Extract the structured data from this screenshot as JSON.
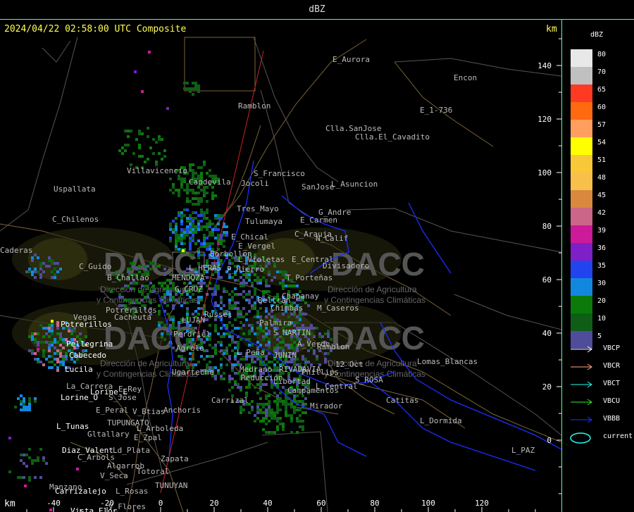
{
  "window": {
    "title": "dBZ"
  },
  "map": {
    "timestamp": "2024/04/22 02:58:00 UTC Composite",
    "km_unit_top": "km",
    "km_unit_bottom": "km",
    "x_ticks": [
      "-40",
      "-20",
      "0",
      "20",
      "40",
      "60",
      "80",
      "100",
      "120"
    ],
    "y_ticks": [
      "140",
      "120",
      "100",
      "80",
      "60",
      "40",
      "20",
      "0"
    ],
    "watermark": {
      "brand": "DACC",
      "line1": "Dirección de Agricultura",
      "line2": "y Contingencias Climáticas"
    },
    "places": [
      {
        "name": "Ramblon",
        "c": "#bbb"
      },
      {
        "name": "Encon",
        "c": "#bbb"
      },
      {
        "name": "E_1-736",
        "c": "#bbb"
      },
      {
        "name": "Clla.SanJose",
        "c": "#bbb"
      },
      {
        "name": "Clla.El_Cavadito",
        "c": "#bbb"
      },
      {
        "name": "Villavicencio",
        "c": "#bbb"
      },
      {
        "name": "SanJose",
        "c": "#bbb"
      },
      {
        "name": "S_Francisco",
        "c": "#bbb"
      },
      {
        "name": "Capdevila",
        "c": "#bbb"
      },
      {
        "name": "Jocoli",
        "c": "#bbb"
      },
      {
        "name": "L_Asuncion",
        "c": "#bbb"
      },
      {
        "name": "Uspallata",
        "c": "#bbb"
      },
      {
        "name": "Tres_Mayo",
        "c": "#bbb"
      },
      {
        "name": "G_Andre",
        "c": "#bbb"
      },
      {
        "name": "Tulumaya",
        "c": "#bbb"
      },
      {
        "name": "E_Carmen",
        "c": "#bbb"
      },
      {
        "name": "C_Chilenos",
        "c": "#bbb"
      },
      {
        "name": "E_Chical",
        "c": "#bbb"
      },
      {
        "name": "C_Arauja",
        "c": "#bbb"
      },
      {
        "name": "N_Calif",
        "c": "#bbb"
      },
      {
        "name": "E_Vergel",
        "c": "#bbb"
      },
      {
        "name": "Borbollon",
        "c": "#bbb"
      },
      {
        "name": "L_Violetas",
        "c": "#bbb"
      },
      {
        "name": "E_Central",
        "c": "#bbb"
      },
      {
        "name": "Divisadero",
        "c": "#bbb"
      },
      {
        "name": "C_Guido",
        "c": "#bbb"
      },
      {
        "name": "L_HERAS",
        "c": "#bbb"
      },
      {
        "name": "P_Hierro",
        "c": "#bbb"
      },
      {
        "name": "MENDOZA",
        "c": "#bbb"
      },
      {
        "name": "B_Challao",
        "c": "#bbb"
      },
      {
        "name": "T_Porteñas",
        "c": "#bbb"
      },
      {
        "name": "G_CRUZ",
        "c": "#bbb"
      },
      {
        "name": "Chapanay",
        "c": "#bbb"
      },
      {
        "name": "Beltran",
        "c": "#bbb"
      },
      {
        "name": "Chimbas",
        "c": "#bbb"
      },
      {
        "name": "M_Caseros",
        "c": "#bbb"
      },
      {
        "name": "Potrerillos",
        "c": "#bbb"
      },
      {
        "name": "Vegas",
        "c": "#bbb"
      },
      {
        "name": "Cacheuta",
        "c": "#bbb"
      },
      {
        "name": "LUJAN",
        "c": "#bbb"
      },
      {
        "name": "Russel",
        "c": "#bbb"
      },
      {
        "name": "Palmira",
        "c": "#bbb"
      },
      {
        "name": "S_MARTIN",
        "c": "#bbb"
      },
      {
        "name": "Potrerillos",
        "c": "#fff"
      },
      {
        "name": "Perdriel",
        "c": "#bbb"
      },
      {
        "name": "Pellegrina",
        "c": "#fff"
      },
      {
        "name": "A_Verde",
        "c": "#bbb"
      },
      {
        "name": "Ramblon",
        "c": "#bbb"
      },
      {
        "name": "Agrelo",
        "c": "#bbb"
      },
      {
        "name": "JUNIN",
        "c": "#bbb"
      },
      {
        "name": "Cabecedo",
        "c": "#fff"
      },
      {
        "name": "L_Peña",
        "c": "#bbb"
      },
      {
        "name": "Lomas_Blancas",
        "c": "#bbb"
      },
      {
        "name": "Lucila",
        "c": "#fff"
      },
      {
        "name": "12_Oct",
        "c": "#bbb"
      },
      {
        "name": "Medrano",
        "c": "#bbb"
      },
      {
        "name": "RIVADAVIA",
        "c": "#bbb"
      },
      {
        "name": "Phillips",
        "c": "#bbb"
      },
      {
        "name": "Ugarteche",
        "c": "#bbb"
      },
      {
        "name": "Reducción",
        "c": "#bbb"
      },
      {
        "name": "S_ROSA",
        "c": "#bbb"
      },
      {
        "name": "Libertad",
        "c": "#bbb"
      },
      {
        "name": "La_Carrera",
        "c": "#bbb"
      },
      {
        "name": "E_Rey",
        "c": "#bbb"
      },
      {
        "name": "L_Central",
        "c": "#bbb"
      },
      {
        "name": "Lorine_E",
        "c": "#fff"
      },
      {
        "name": "Campamentos",
        "c": "#bbb"
      },
      {
        "name": "Lorine_O",
        "c": "#fff"
      },
      {
        "name": "S_Jose",
        "c": "#bbb"
      },
      {
        "name": "Carrizal",
        "c": "#bbb"
      },
      {
        "name": "Catitas",
        "c": "#bbb"
      },
      {
        "name": "Mirador",
        "c": "#bbb"
      },
      {
        "name": "E_Peral",
        "c": "#bbb"
      },
      {
        "name": "V_Btias",
        "c": "#bbb"
      },
      {
        "name": "Anchoris",
        "c": "#bbb"
      },
      {
        "name": "TUPUNGATO",
        "c": "#bbb"
      },
      {
        "name": "L_Dormida",
        "c": "#bbb"
      },
      {
        "name": "L_Tunas",
        "c": "#fff"
      },
      {
        "name": "L_Arboleda",
        "c": "#bbb"
      },
      {
        "name": "Gltallary",
        "c": "#bbb"
      },
      {
        "name": "E_Zpal",
        "c": "#bbb"
      },
      {
        "name": "Diaz_Valent",
        "c": "#fff"
      },
      {
        "name": "L_PAZ",
        "c": "#bbb"
      },
      {
        "name": "Ld_Plata",
        "c": "#bbb"
      },
      {
        "name": "C_Arbols",
        "c": "#bbb"
      },
      {
        "name": "Zapata",
        "c": "#bbb"
      },
      {
        "name": "Algarrob",
        "c": "#bbb"
      },
      {
        "name": "Totoral",
        "c": "#bbb"
      },
      {
        "name": "V_Seca",
        "c": "#bbb"
      },
      {
        "name": "Manzano",
        "c": "#bbb"
      },
      {
        "name": "Carrizalejo",
        "c": "#fff"
      },
      {
        "name": "L_Rosas",
        "c": "#bbb"
      },
      {
        "name": "TUNUYAN",
        "c": "#bbb"
      },
      {
        "name": "V_Flores",
        "c": "#bbb"
      },
      {
        "name": "Vista_Flor",
        "c": "#fff"
      },
      {
        "name": "Caderas",
        "c": "#bbb"
      },
      {
        "name": "E_Aurora",
        "c": "#bbb"
      }
    ]
  },
  "legend": {
    "title": "dBZ",
    "scale": [
      {
        "value": "80",
        "color": "#e8e8e8"
      },
      {
        "value": "70",
        "color": "#c0c0c0"
      },
      {
        "value": "65",
        "color": "#ff3a22"
      },
      {
        "value": "60",
        "color": "#ff6a10"
      },
      {
        "value": "57",
        "color": "#ff9e5e"
      },
      {
        "value": "54",
        "color": "#ffff00"
      },
      {
        "value": "51",
        "color": "#f9c838"
      },
      {
        "value": "48",
        "color": "#f8c04a"
      },
      {
        "value": "45",
        "color": "#d9883e"
      },
      {
        "value": "42",
        "color": "#cc6688"
      },
      {
        "value": "39",
        "color": "#cc1a9a"
      },
      {
        "value": "36",
        "color": "#7f1fc8"
      },
      {
        "value": "35",
        "color": "#2244ee"
      },
      {
        "value": "30",
        "color": "#1188dd"
      },
      {
        "value": "20",
        "color": "#0b7a0b"
      },
      {
        "value": "10",
        "color": "#0e5e16"
      },
      {
        "value": "5",
        "color": "#504c9c"
      }
    ],
    "lines": [
      {
        "label": "VBCP",
        "color": "#ffffff"
      },
      {
        "label": "VBCR",
        "color": "#ffaa88"
      },
      {
        "label": "VBCT",
        "color": "#22ffee"
      },
      {
        "label": "VBCU",
        "color": "#33ee33"
      },
      {
        "label": "VBBB",
        "color": "#2233ff"
      }
    ],
    "current_label": "current",
    "current_color": "#22ffee"
  },
  "colors": {
    "frame": "#55ffaa",
    "river": "#1a2eff",
    "road": "#7a6438",
    "border": "#555555",
    "radial": "#cc2222"
  }
}
